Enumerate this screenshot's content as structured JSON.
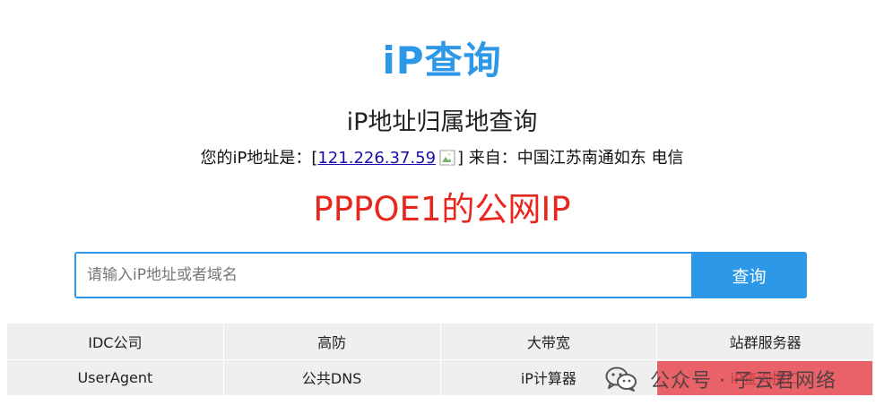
{
  "logo": {
    "text": "iP查询",
    "color": "#2d97e8"
  },
  "page_title": "iP地址归属地查询",
  "ip_info": {
    "prefix": "您的iP地址是：[",
    "ip": "121.226.37.59",
    "suffix": "] 来自：中国江苏南通如东 电信"
  },
  "annotation": {
    "text": "PPPOE1的公网IP",
    "color": "#e8261e"
  },
  "search": {
    "placeholder": "请输入iP地址或者域名",
    "value": "",
    "button_label": "查询"
  },
  "links": [
    {
      "label": "IDC公司"
    },
    {
      "label": "高防"
    },
    {
      "label": "大带宽"
    },
    {
      "label": "站群服务器"
    },
    {
      "label": "UserAgent"
    },
    {
      "label": "公共DNS"
    },
    {
      "label": "iP计算器"
    },
    {
      "label": "iP查询接口"
    }
  ],
  "watermark": {
    "text": "公众号 · 子云君网络",
    "icon": "wechat-icon"
  },
  "colors": {
    "accent": "#2d97e8",
    "annotation": "#e8261e",
    "link_cell_bg": "#efefef"
  }
}
